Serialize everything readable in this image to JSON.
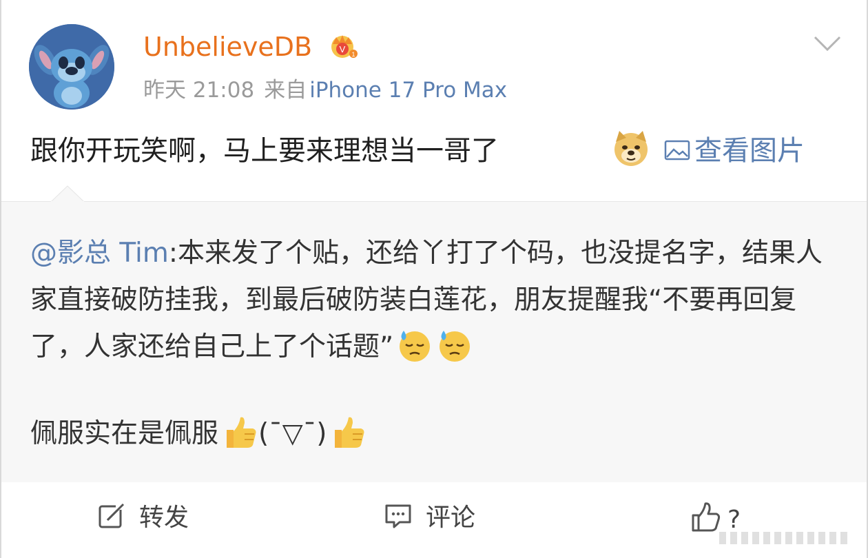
{
  "post": {
    "author": {
      "username": "UnbelieveDB",
      "badge_icon": "crown-icon",
      "avatar_icon": "stitch-avatar"
    },
    "meta": {
      "time": "昨天 21:08",
      "source_prefix": "来自",
      "source": "iPhone 17 Pro Max"
    },
    "text": "跟你开玩笑啊，马上要来理想当一哥了",
    "text_emoji": "doge-emoji",
    "view_picture_label": "查看图片"
  },
  "repost": {
    "mention": "@影总 Tim",
    "body": ":本来发了个贴，还给丫打了个码，也没提名字，结果人家直接破防挂我，到最后破防装白莲花，朋友提醒我“不要再回复了，人家还给自己上了个话题”",
    "body_emojis": [
      "sweat-emoji",
      "sweat-emoji"
    ],
    "praise_part1": "佩服实在是佩服",
    "praise_kaomoji": "(¯▽¯)",
    "praise_emojis": [
      "thumbs-up-emoji",
      "thumbs-up-emoji"
    ]
  },
  "actions": {
    "repost_label": "转发",
    "comment_label": "评论",
    "like_label": "?"
  },
  "colors": {
    "username": "#e8711d",
    "link": "#5b7fb1",
    "meta": "#9a9a9a",
    "repost_bg": "#f7f7f7"
  }
}
